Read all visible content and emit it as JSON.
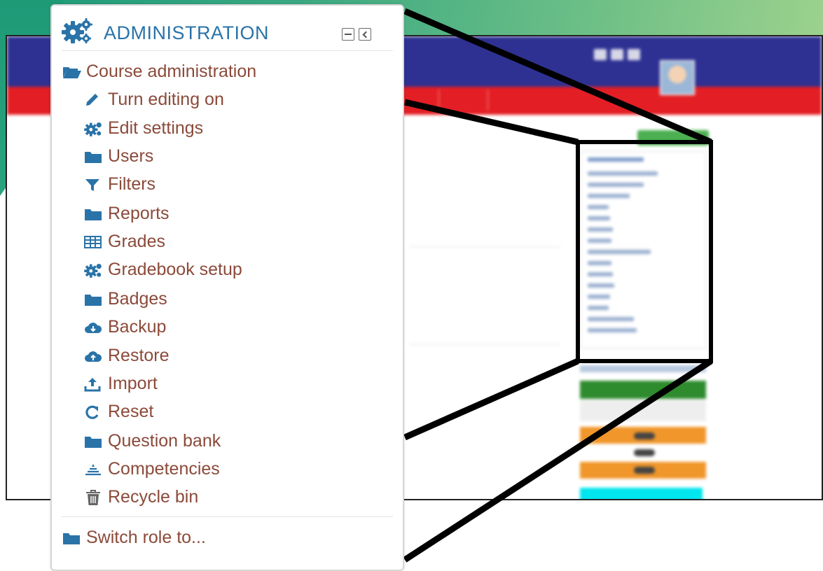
{
  "admin_block": {
    "title": "ADMINISTRATION",
    "minimize_control": "collapse",
    "dock_control": "dock",
    "course_admin": {
      "label": "Course administration",
      "icon": "folder-open-icon",
      "items": [
        {
          "label": "Turn editing on",
          "icon": "pencil-icon"
        },
        {
          "label": "Edit settings",
          "icon": "cogs-icon"
        },
        {
          "label": "Users",
          "icon": "folder-icon"
        },
        {
          "label": "Filters",
          "icon": "filter-icon"
        },
        {
          "label": "Reports",
          "icon": "folder-icon"
        },
        {
          "label": "Grades",
          "icon": "table-icon"
        },
        {
          "label": "Gradebook setup",
          "icon": "cogs-icon"
        },
        {
          "label": "Badges",
          "icon": "folder-icon"
        },
        {
          "label": "Backup",
          "icon": "cloud-download-icon"
        },
        {
          "label": "Restore",
          "icon": "cloud-upload-icon"
        },
        {
          "label": "Import",
          "icon": "upload-icon"
        },
        {
          "label": "Reset",
          "icon": "refresh-icon"
        },
        {
          "label": "Question bank",
          "icon": "folder-icon"
        },
        {
          "label": "Competencies",
          "icon": "competencies-icon"
        },
        {
          "label": "Recycle bin",
          "icon": "trash-icon"
        }
      ]
    },
    "switch_role": {
      "label": "Switch role to...",
      "icon": "folder-icon"
    }
  },
  "colors": {
    "accent_blue": "#2a73a8",
    "link_brown": "#8b4a3a",
    "header_navy": "#2e3192",
    "nav_red": "#e31e24",
    "green_bg": "#3aa882"
  }
}
